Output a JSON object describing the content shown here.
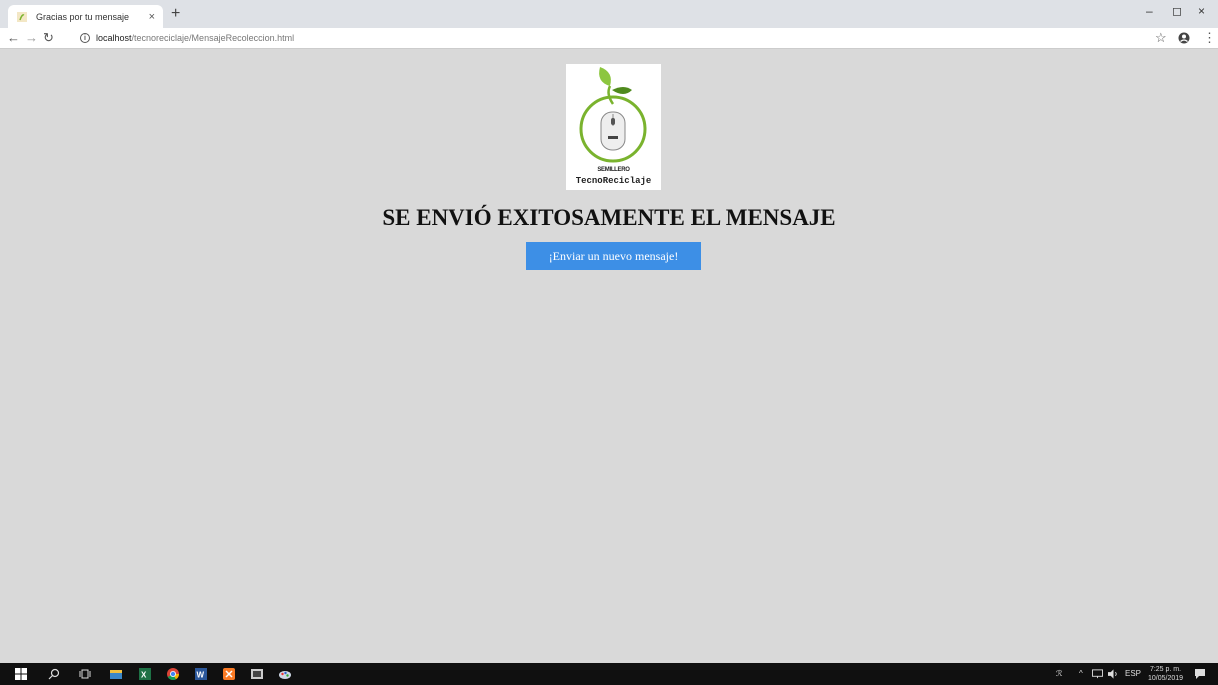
{
  "browser": {
    "tab_title": "Gracias por tu mensaje",
    "tab_close": "×",
    "new_tab": "+",
    "url_host": "localhost",
    "url_path": "/tecnoreciclaje/MensajeRecoleccion.html",
    "window_controls": {
      "minimize": "–",
      "maximize": "◻",
      "close": "×"
    }
  },
  "page": {
    "logo_line1": "SEMILLERO",
    "logo_line2": "TecnoReciclaje",
    "headline": "SE ENVIÓ EXITOSAMENTE EL MENSAJE",
    "button_label": "¡Enviar un nuevo mensaje!"
  },
  "taskbar": {
    "language": "ESP",
    "time": "7:25 p. m.",
    "date": "10/05/2019"
  },
  "colors": {
    "page_bg": "#d9d9d9",
    "button_bg": "#3d8fe6",
    "logo_green": "#7ab32e"
  },
  "icons": {
    "back": "back-arrow-icon",
    "forward": "forward-arrow-icon",
    "reload": "reload-icon",
    "info": "info-icon",
    "bookmark": "star-icon",
    "profile": "profile-icon",
    "menu": "kebab-menu-icon"
  }
}
